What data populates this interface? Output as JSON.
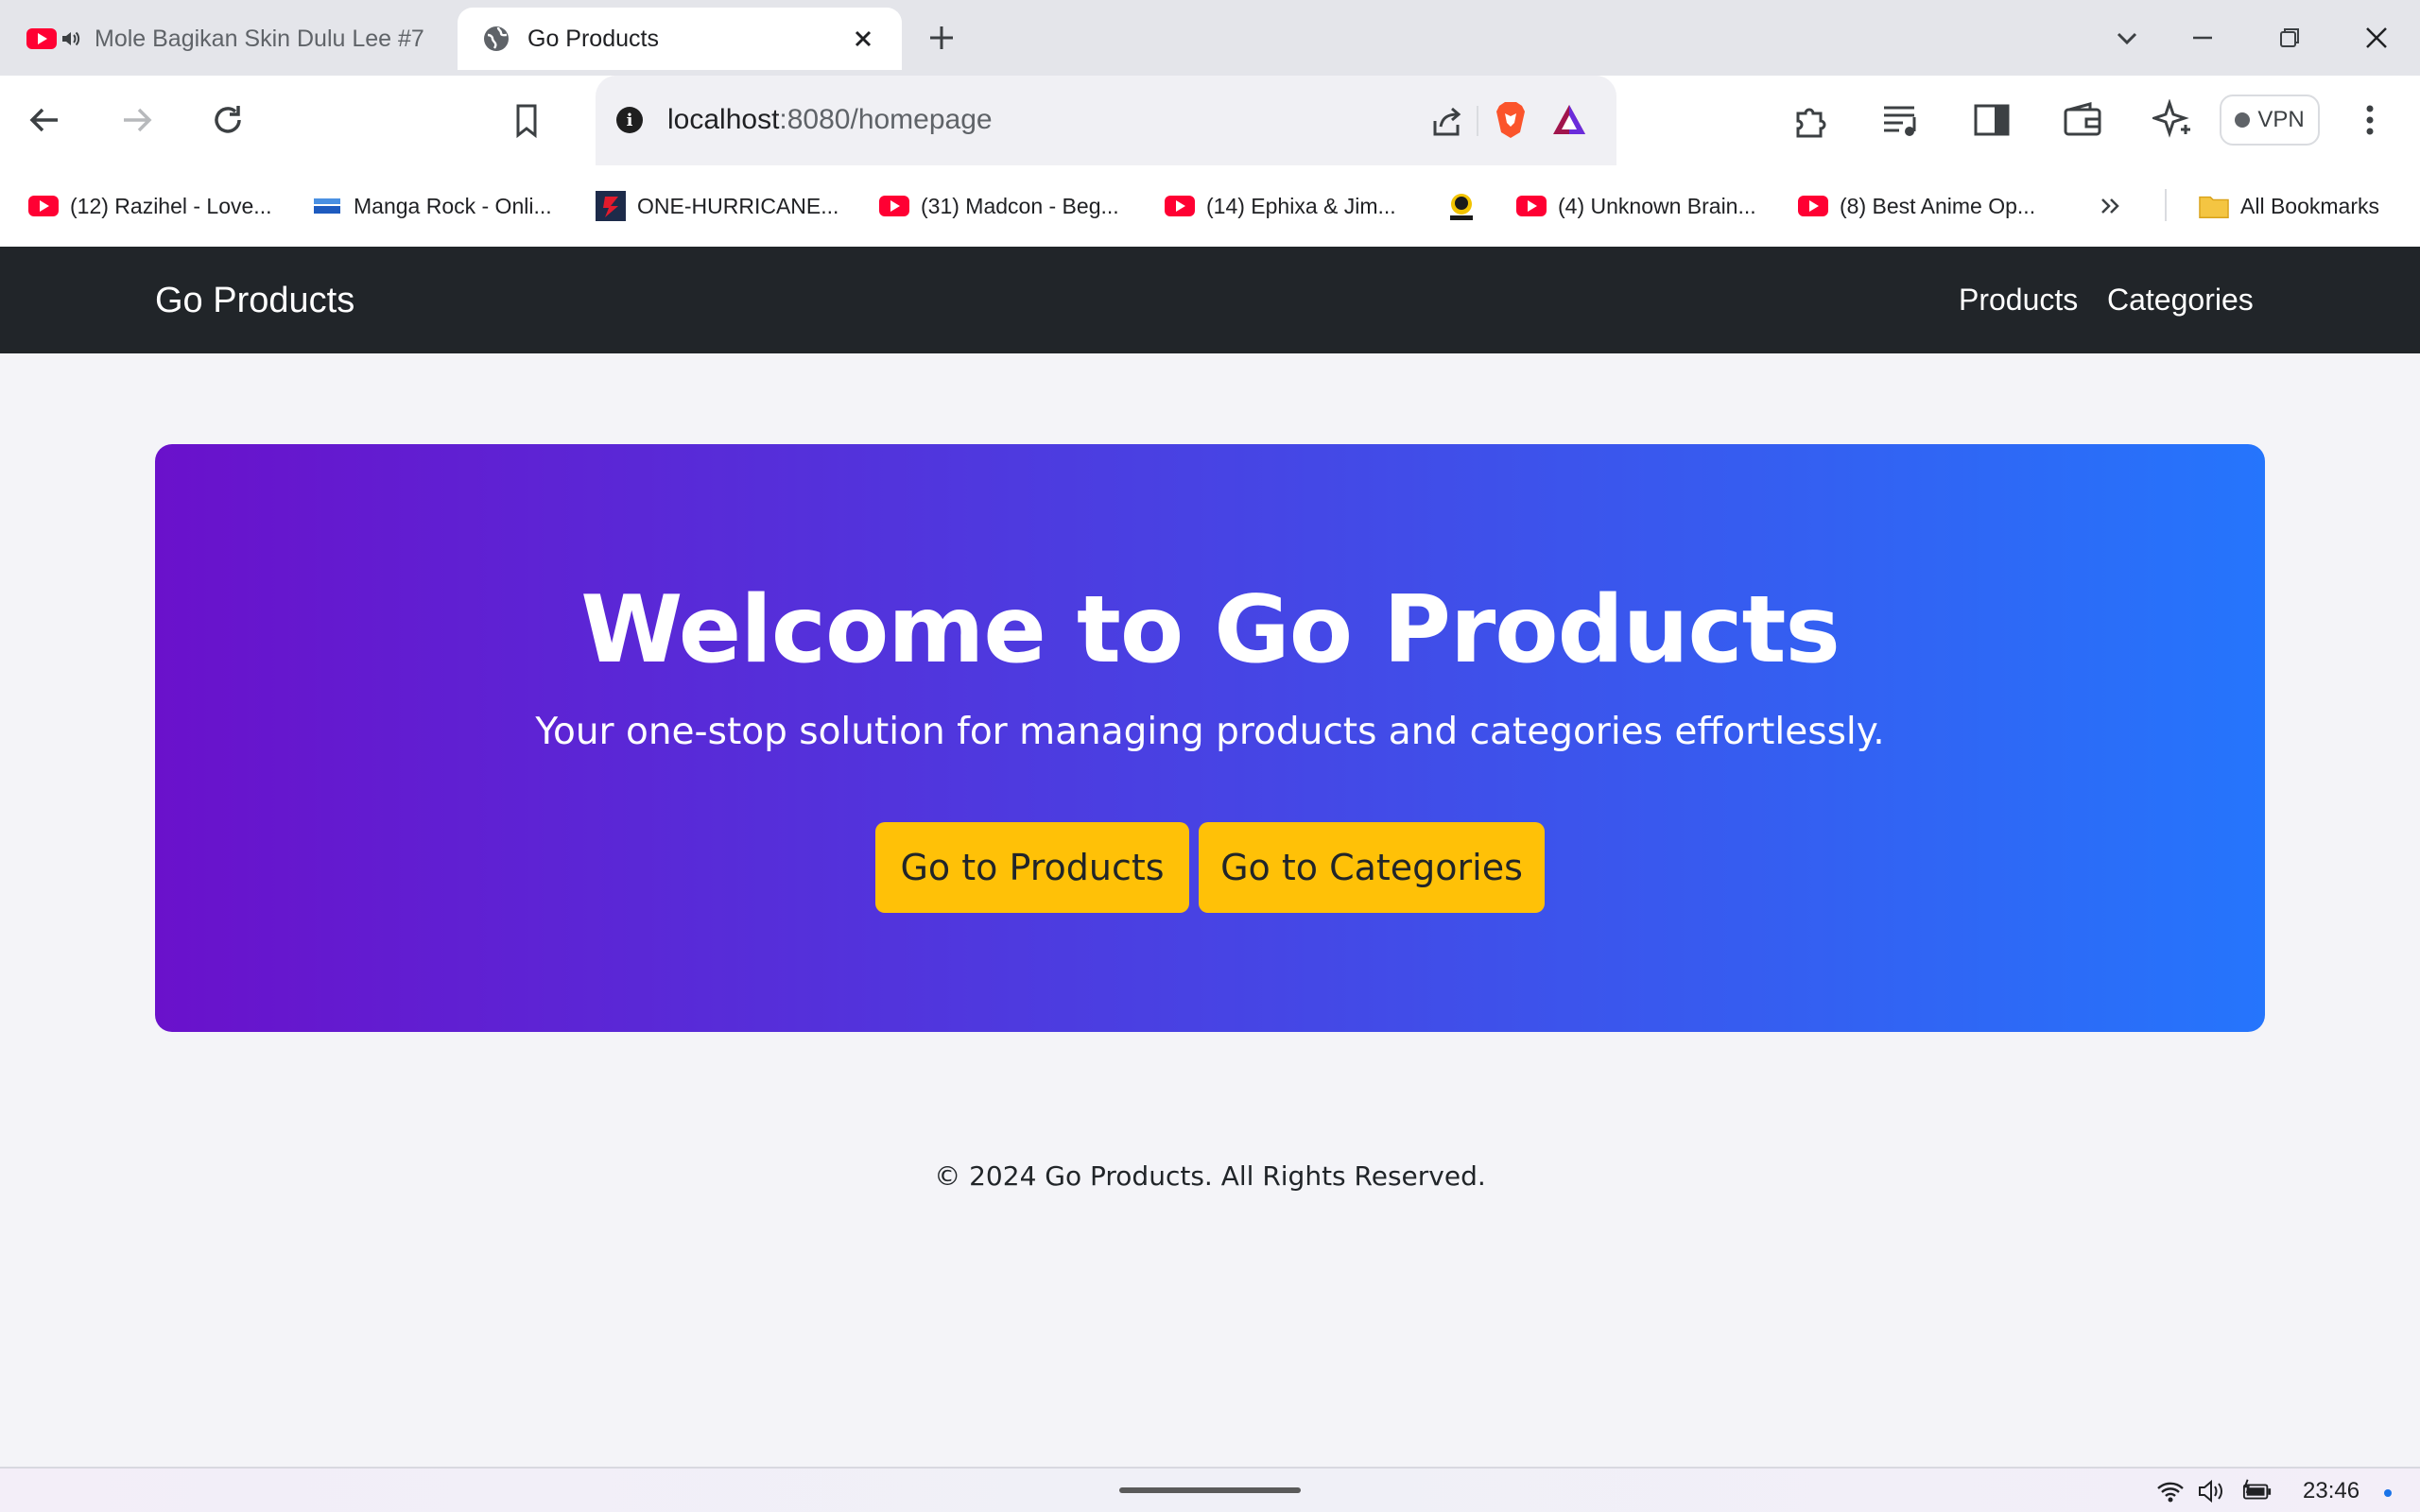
{
  "browser": {
    "tabs": [
      {
        "title": "Mole Bagikan Skin Dulu Lee #7",
        "icon": "youtube-icon",
        "audio": "speaker-icon"
      },
      {
        "title": "Go Products",
        "icon": "globe-icon"
      }
    ],
    "address": {
      "host": "localhost",
      "rest": ":8080/homepage"
    },
    "vpn_label": "VPN",
    "bookmarks": [
      {
        "label": "(12) Razihel - Love...",
        "icon": "youtube-icon"
      },
      {
        "label": "Manga Rock - Onli...",
        "icon": "manga-rock-icon"
      },
      {
        "label": "ONE-HURRICANE...",
        "icon": "hurricane-icon"
      },
      {
        "label": "(31) Madcon - Beg...",
        "icon": "youtube-icon"
      },
      {
        "label": "(14) Ephixa & Jim...",
        "icon": "youtube-icon"
      },
      {
        "label": "",
        "icon": "avatar-icon"
      },
      {
        "label": "(4) Unknown Brain...",
        "icon": "youtube-icon"
      },
      {
        "label": "(8) Best Anime Op...",
        "icon": "youtube-icon"
      }
    ],
    "all_bookmarks_label": "All Bookmarks"
  },
  "app": {
    "brand": "Go Products",
    "nav": [
      "Products",
      "Categories"
    ],
    "hero": {
      "title": "Welcome to Go Products",
      "subtitle": "Your one-stop solution for managing products and categories effortlessly.",
      "buttons": [
        "Go to Products",
        "Go to Categories"
      ],
      "gradient_start": "#6a11cb",
      "gradient_end": "#2575fc",
      "button_color": "#ffc107"
    },
    "footer": "© 2024 Go Products. All Rights Reserved."
  },
  "taskbar": {
    "time": "23:46"
  }
}
